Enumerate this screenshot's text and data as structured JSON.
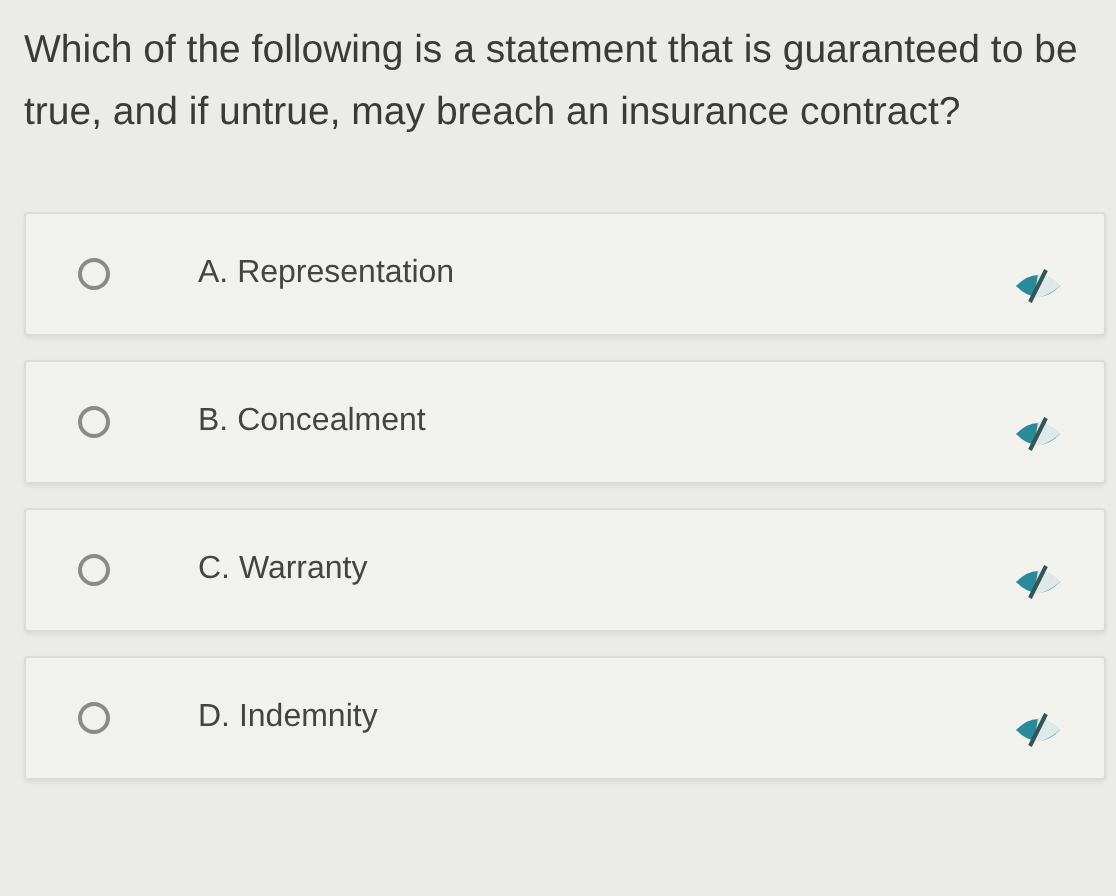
{
  "question": "Which of the following is a statement that is guaranteed to be true, and if untrue, may breach an insurance contract?",
  "options": [
    {
      "label": "A. Representation",
      "selected": false
    },
    {
      "label": "B. Concealment",
      "selected": false
    },
    {
      "label": "C. Warranty",
      "selected": false
    },
    {
      "label": "D. Indemnity",
      "selected": false
    }
  ]
}
